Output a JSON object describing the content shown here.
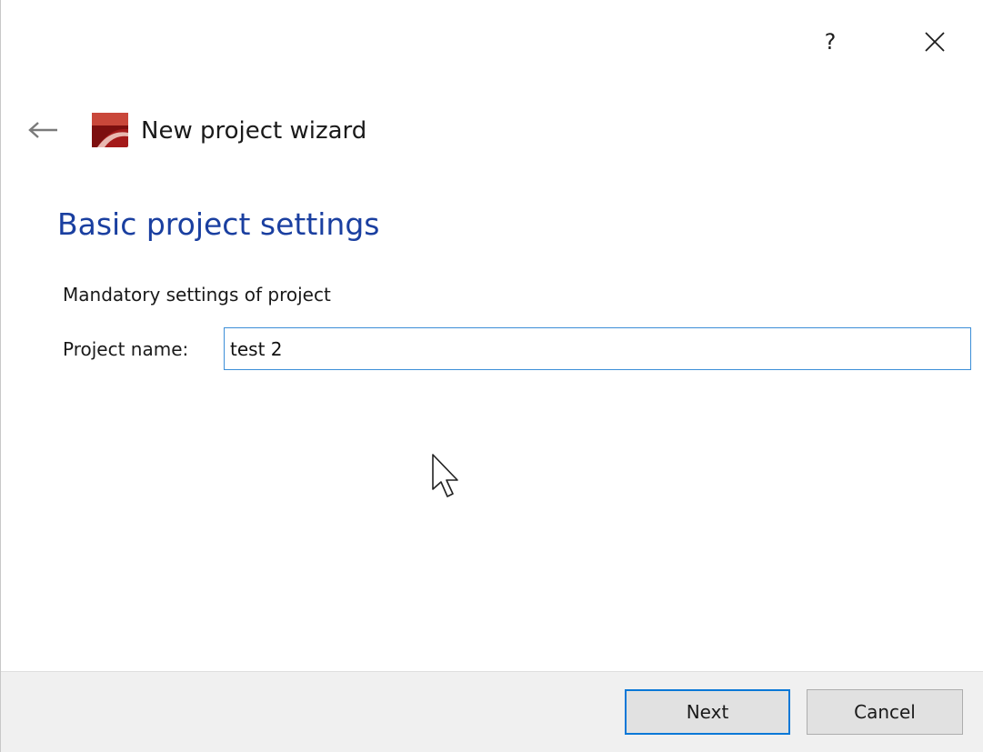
{
  "titlebar": {
    "help_label": "?"
  },
  "header": {
    "wizard_title": "New project wizard"
  },
  "page": {
    "heading": "Basic project settings",
    "section_label": "Mandatory settings of project",
    "project_name_label": "Project name:",
    "project_name_value": "test 2"
  },
  "footer": {
    "next_label": "Next",
    "cancel_label": "Cancel"
  },
  "colors": {
    "heading": "#1a3fa0",
    "input_focus_border": "#3c8ed8",
    "default_button_border": "#0a78d7",
    "footer_background": "#f0f0f0"
  },
  "icons": {
    "help": "help-icon",
    "close": "close-icon",
    "back": "back-arrow-icon",
    "app": "app-logo-icon",
    "cursor": "mouse-cursor-icon"
  }
}
